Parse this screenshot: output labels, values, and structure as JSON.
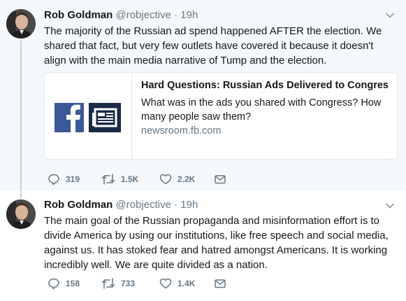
{
  "tweets": [
    {
      "author_name": "Rob Goldman",
      "author_handle": "@robjective",
      "time": "19h",
      "text": "The majority of the Russian ad spend happened AFTER the election.  We shared that fact, but very few outlets have covered it because it doesn't align with the main media narrative of Tump and the election.",
      "card": {
        "title": "Hard Questions: Russian Ads Delivered to Congres...",
        "description": "What was in the ads you shared with Congress? How many people saw them?",
        "domain": "newsroom.fb.com"
      },
      "replies": "319",
      "retweets": "1.5K",
      "likes": "2.2K"
    },
    {
      "author_name": "Rob Goldman",
      "author_handle": "@robjective",
      "time": "19h",
      "text": "The main goal of the Russian propaganda and misinformation effort is to divide America by using our institutions, like free speech and social media, against us. It has stoked fear and hatred amongst Americans.  It is working incredibly well. We are quite divided as a nation.",
      "replies": "158",
      "retweets": "733",
      "likes": "1.4K"
    }
  ],
  "separator": " · ",
  "icons": [
    "chevron-down-icon",
    "reply-icon",
    "retweet-icon",
    "like-icon",
    "direct-message-icon",
    "facebook-logo-icon",
    "newsroom-icon"
  ],
  "colors": {
    "background_highlight": "#f5f8fa",
    "thread_line": "#c4cfd6",
    "muted_text": "#657786",
    "facebook_blue": "#3b5998",
    "newsroom_navy": "#1a2a47"
  }
}
